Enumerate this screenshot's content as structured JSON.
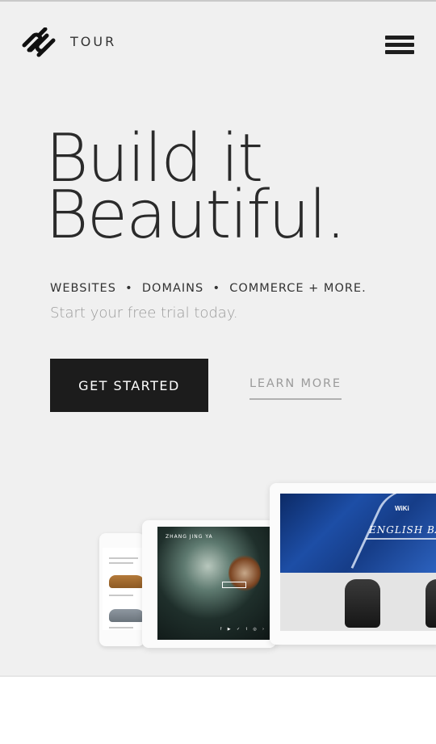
{
  "header": {
    "logo_icon": "squarespace-logo-icon",
    "nav_label": "TOUR",
    "menu_icon": "hamburger-menu-icon"
  },
  "hero": {
    "headline_line1": "Build it",
    "headline_line2": "Beautiful.",
    "tagline": "WEBSITES  •  DOMAINS  •  COMMERCE + MORE.",
    "subline": "Start your free trial today.",
    "primary_button": "GET STARTED",
    "secondary_link": "LEARN MORE"
  },
  "showcase": {
    "tablet_site_title": "ZHANG JING YA",
    "tablet_social": "f ▶ ✓ t ◎ ›",
    "laptop_site_title": "ENGLISH BAG",
    "laptop_brand": "WiKi"
  },
  "colors": {
    "background": "#f0f0f0",
    "primary_button_bg": "#1c1c1c",
    "link_color": "#9b9b9b"
  }
}
